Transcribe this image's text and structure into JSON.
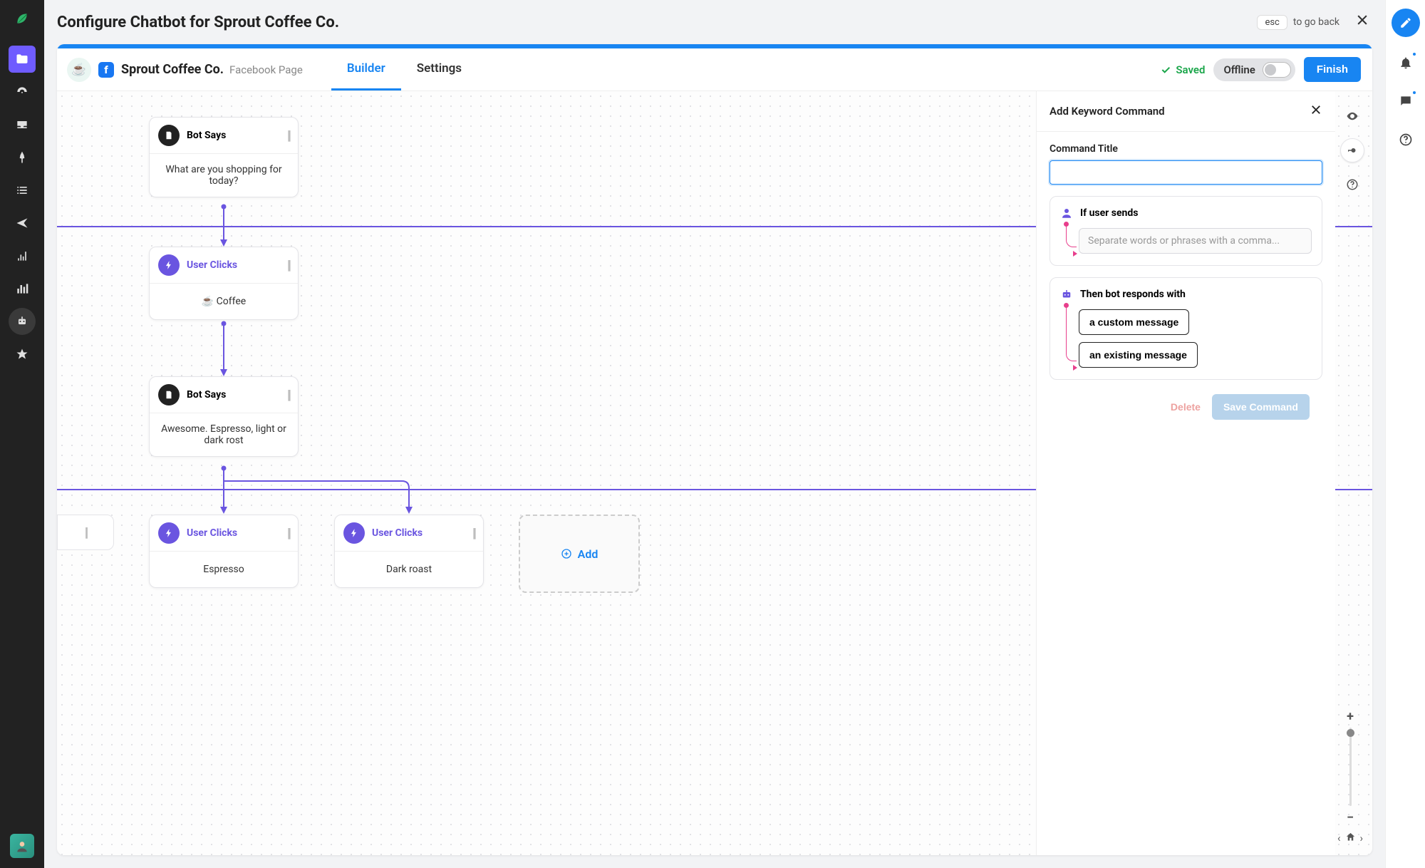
{
  "header": {
    "title": "Configure Chatbot for Sprout Coffee Co.",
    "esc_label": "esc",
    "go_back": "to go back"
  },
  "subheader": {
    "brand_emoji": "☕",
    "brand_name": "Sprout Coffee Co.",
    "brand_subtext": "Facebook Page",
    "tabs": {
      "builder": "Builder",
      "settings": "Settings"
    },
    "saved_label": "Saved",
    "offline_label": "Offline",
    "finish_label": "Finish"
  },
  "nodes": {
    "botsays1": {
      "label": "Bot Says",
      "body": "What are you shopping for today?"
    },
    "userclicks1": {
      "label": "User Clicks",
      "body": "☕ Coffee"
    },
    "botsays2": {
      "label": "Bot Says",
      "body": "Awesome. Espresso, light or dark rost"
    },
    "userclicks2": {
      "label": "User Clicks",
      "body": "Espresso"
    },
    "userclicks3": {
      "label": "User Clicks",
      "body": "Dark roast"
    },
    "add_label": "Add"
  },
  "panel": {
    "title": "Add Keyword Command",
    "command_title_label": "Command Title",
    "if_user_sends": "If user sends",
    "sends_placeholder": "Separate words or phrases with a comma...",
    "then_responds": "Then bot responds with",
    "opt_custom": "a custom message",
    "opt_existing": "an existing message",
    "delete_label": "Delete",
    "save_label": "Save Command"
  },
  "icons": {
    "drag": "||"
  }
}
